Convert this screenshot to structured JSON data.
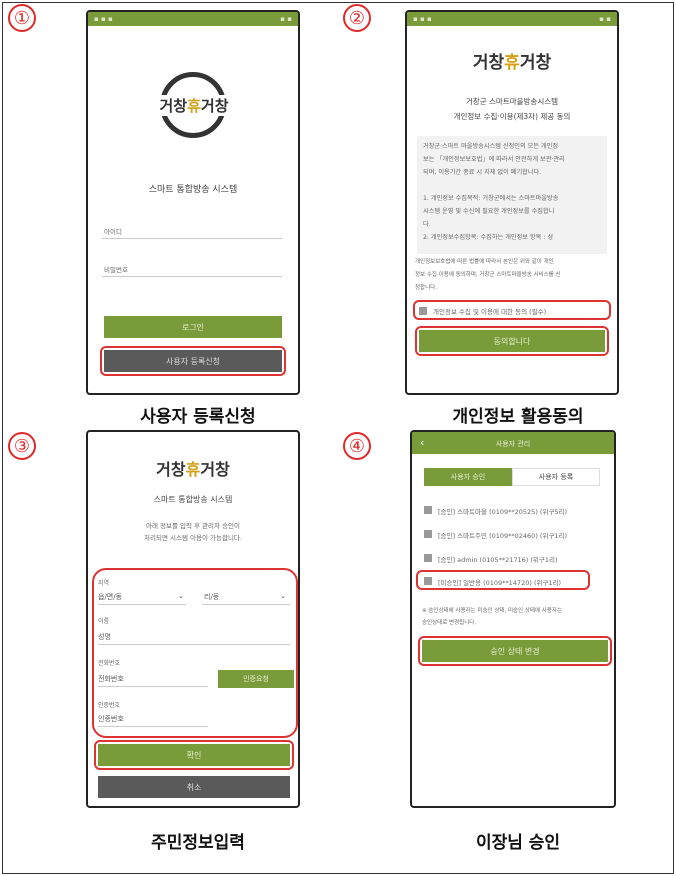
{
  "steps": [
    "①",
    "②",
    "③",
    "④"
  ],
  "captions": {
    "s1": "사용자 등록신청",
    "s2": "개인정보 활용동의",
    "s3": "주민정보입력",
    "s4": "이장님 승인"
  },
  "logo": {
    "text_left": "거창",
    "text_right": "거창",
    "mark": "휴"
  },
  "screen1": {
    "system_title": "스마트 통합방송 시스템",
    "id_placeholder": "아이디",
    "pw_placeholder": "비밀번호",
    "login_button": "로그인",
    "register_button": "사용자 등록신청"
  },
  "screen2": {
    "heading_line1": "거창군 스마트마을방송시스템",
    "heading_line2": "개인정보 수집·이용(제3자) 제공 동의",
    "body_lines": [
      "거창군 스마트 마을방송시스템 신청인의 모든 개인정",
      "보는 「개인정보보호법」에 따라서 안전하게 보관·관리",
      "되며, 이용기간 종료 시 지체 없이 폐기합니다.",
      "",
      "1. 개인정보 수집목적: 거창군에서는 스마트마을방송",
      "시스템 운영 및 수신에 필요한 개인정보를 수집합니",
      "다.",
      "2. 개인정보수집항목: 수집하는 개인정보 항목 : 성"
    ],
    "notice_lines": [
      "개인정보보호법에 따른 법률에 따라서 본인은 위와 같이 개인",
      "정보 수집·이용에 동의하며, 거창군 스마트마을방송 서비스를 신",
      "청합니다."
    ],
    "checkbox_label": "개인정보 수집 및 이용에 대한 동의 (필수)",
    "agree_button": "동의합니다"
  },
  "screen3": {
    "system_title": "스마트 통합방송 시스템",
    "instruction_line1": "아래 정보를 입력 후 관리자 승인이",
    "instruction_line2": "처리되면 시스템 이용이 가능합니다.",
    "region_label": "지역",
    "region_value1": "읍/면/동",
    "region_value2": "리/동",
    "name_label": "이름",
    "name_value": "성명",
    "phone_label": "전화번호",
    "phone_value": "전화번호",
    "verify_button": "인증요청",
    "code_label": "인증번호",
    "code_value": "인증번호",
    "confirm_button": "확인",
    "cancel_button": "취소"
  },
  "screen4": {
    "header_title": "사용자 관리",
    "back_icon": "‹",
    "tab_approve": "사용자 승인",
    "tab_register": "사용자 등록",
    "users": [
      "[승인] 스마트마을 (0109**20525) (위구5리)",
      "[승인] 스마트주민 (0109**02460) (위구1리)",
      "[승인] admin (0105**21716) (위구1리)",
      "[미승인] 일반용 (0109**14720) (위구1리)"
    ],
    "note_line1": "※ 승인상태에 사용자는 미승인 상태, 미승인 상태에 사용자는",
    "note_line2": "승인상태로 변경됩니다.",
    "change_button": "승인 상태 변경"
  },
  "colors": {
    "accent": "#7a9b3a",
    "dark_button": "#5a5a5a",
    "highlight": "#dd3333"
  }
}
